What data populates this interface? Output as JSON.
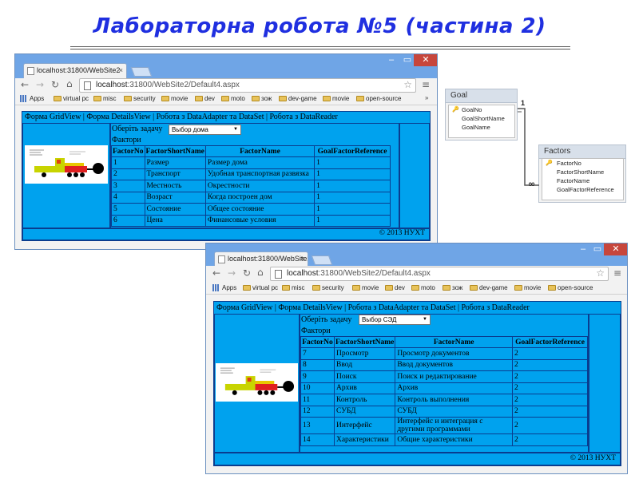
{
  "slide": {
    "title": "Лабораторна робота №5 (частина 2)"
  },
  "windows": [
    {
      "tab_label": "localhost:31800/WebSite2",
      "window_buttons": [
        "–",
        "▭",
        "✕"
      ],
      "url_host": "localhost",
      "url_path": ":31800/WebSite2/Default4.aspx",
      "bookmarks": [
        "Apps",
        "virtual pc",
        "misc",
        "security",
        "movie",
        "dev",
        "moto",
        "зож",
        "dev-game",
        "movie",
        "open-source"
      ],
      "bookmarks_more": "»",
      "nav_links": "Форма GridView | Форма DetailsView | Робота з DataAdapter та DataSet | Робота з DataReader",
      "select_label": "Оберіть задачу",
      "select_value": "Выбор дома",
      "grid_caption": "Фактори",
      "columns": [
        "FactorNo",
        "FactorShortName",
        "FactorName",
        "GoalFactorReference"
      ],
      "rows": [
        [
          "1",
          "Размер",
          "Размер дома",
          "1"
        ],
        [
          "2",
          "Транспорт",
          "Удобная транспортная развязка",
          "1"
        ],
        [
          "3",
          "Местность",
          "Окрестности",
          "1"
        ],
        [
          "4",
          "Возраст",
          "Когда построен дом",
          "1"
        ],
        [
          "5",
          "Состояние",
          "Общее состояние",
          "1"
        ],
        [
          "6",
          "Цена",
          "Финансовые условия",
          "1"
        ]
      ],
      "footer": "© 2013 НУХТ"
    },
    {
      "tab_label": "localhost:31800/WebSite2",
      "window_buttons": [
        "–",
        "▭",
        "✕"
      ],
      "url_host": "localhost",
      "url_path": ":31800/WebSite2/Default4.aspx",
      "bookmarks": [
        "Apps",
        "virtual pc",
        "misc",
        "security",
        "movie",
        "dev",
        "moto",
        "зож",
        "dev-game",
        "movie",
        "open-source"
      ],
      "bookmarks_more": "",
      "nav_links": "Форма GridView | Форма DetailsView | Робота з DataAdapter та DataSet | Робота з DataReader",
      "select_label": "Оберіть задачу",
      "select_value": "Выбор СЭД",
      "grid_caption": "Фактори",
      "columns": [
        "FactorNo",
        "FactorShortName",
        "FactorName",
        "GoalFactorReference"
      ],
      "rows": [
        [
          "7",
          "Просмотр",
          "Просмотр документов",
          "2"
        ],
        [
          "8",
          "Ввод",
          "Ввод документов",
          "2"
        ],
        [
          "9",
          "Поиск",
          "Поиск и редактирование",
          "2"
        ],
        [
          "10",
          "Архив",
          "Архив",
          "2"
        ],
        [
          "11",
          "Контроль",
          "Контроль выполнения",
          "2"
        ],
        [
          "12",
          "СУБД",
          "СУБД",
          "2"
        ],
        [
          "13",
          "Интерфейс",
          "Интерфейс и интеграция с другими программами",
          "2"
        ],
        [
          "14",
          "Характеристики",
          "Общие характеристики",
          "2"
        ]
      ],
      "footer": "© 2013 НУХТ"
    }
  ],
  "er": {
    "goal": {
      "name": "Goal",
      "fields": [
        "GoalNo",
        "GoalShortName",
        "GoalName"
      ]
    },
    "factors": {
      "name": "Factors",
      "fields": [
        "FactorNo",
        "FactorShortName",
        "FactorName",
        "GoalFactorReference"
      ]
    },
    "rel_one": "1",
    "rel_many": "∞"
  }
}
